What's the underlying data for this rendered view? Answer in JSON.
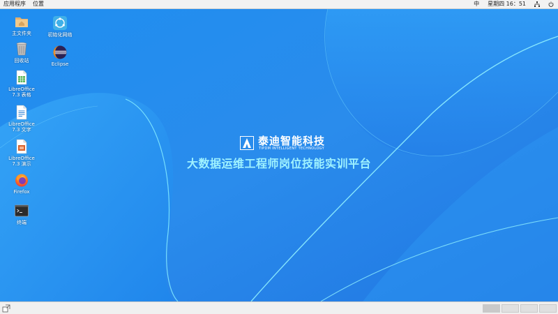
{
  "topbar": {
    "menu_apps": "应用程序",
    "menu_places": "位置",
    "input_method": "中",
    "clock": "星期四 16：51"
  },
  "desktop": {
    "icons": [
      {
        "label": "主文件夹",
        "icon": "home-folder-icon"
      },
      {
        "label": "回收站",
        "icon": "trash-icon"
      },
      {
        "label": "LibreOffice\n7.3 表格",
        "icon": "libreoffice-calc-icon"
      },
      {
        "label": "LibreOffice\n7.3 文字",
        "icon": "libreoffice-writer-icon"
      },
      {
        "label": "LibreOffice\n7.3 演示",
        "icon": "libreoffice-impress-icon"
      },
      {
        "label": "Firefox",
        "icon": "firefox-icon"
      },
      {
        "label": "终端",
        "icon": "terminal-icon"
      },
      {
        "label": "初始化网络",
        "icon": "network-init-icon"
      },
      {
        "label": "Eclipse",
        "icon": "eclipse-icon"
      }
    ]
  },
  "brand": {
    "name": "泰迪智能科技",
    "english": "TIPDM INTELLIGENT TECHNOLOGY",
    "platform_title": "大数据运维工程师岗位技能实训平台"
  },
  "colors": {
    "wallpaper_base": "#2a8ae8",
    "title_accent": "#9ff2ff"
  }
}
